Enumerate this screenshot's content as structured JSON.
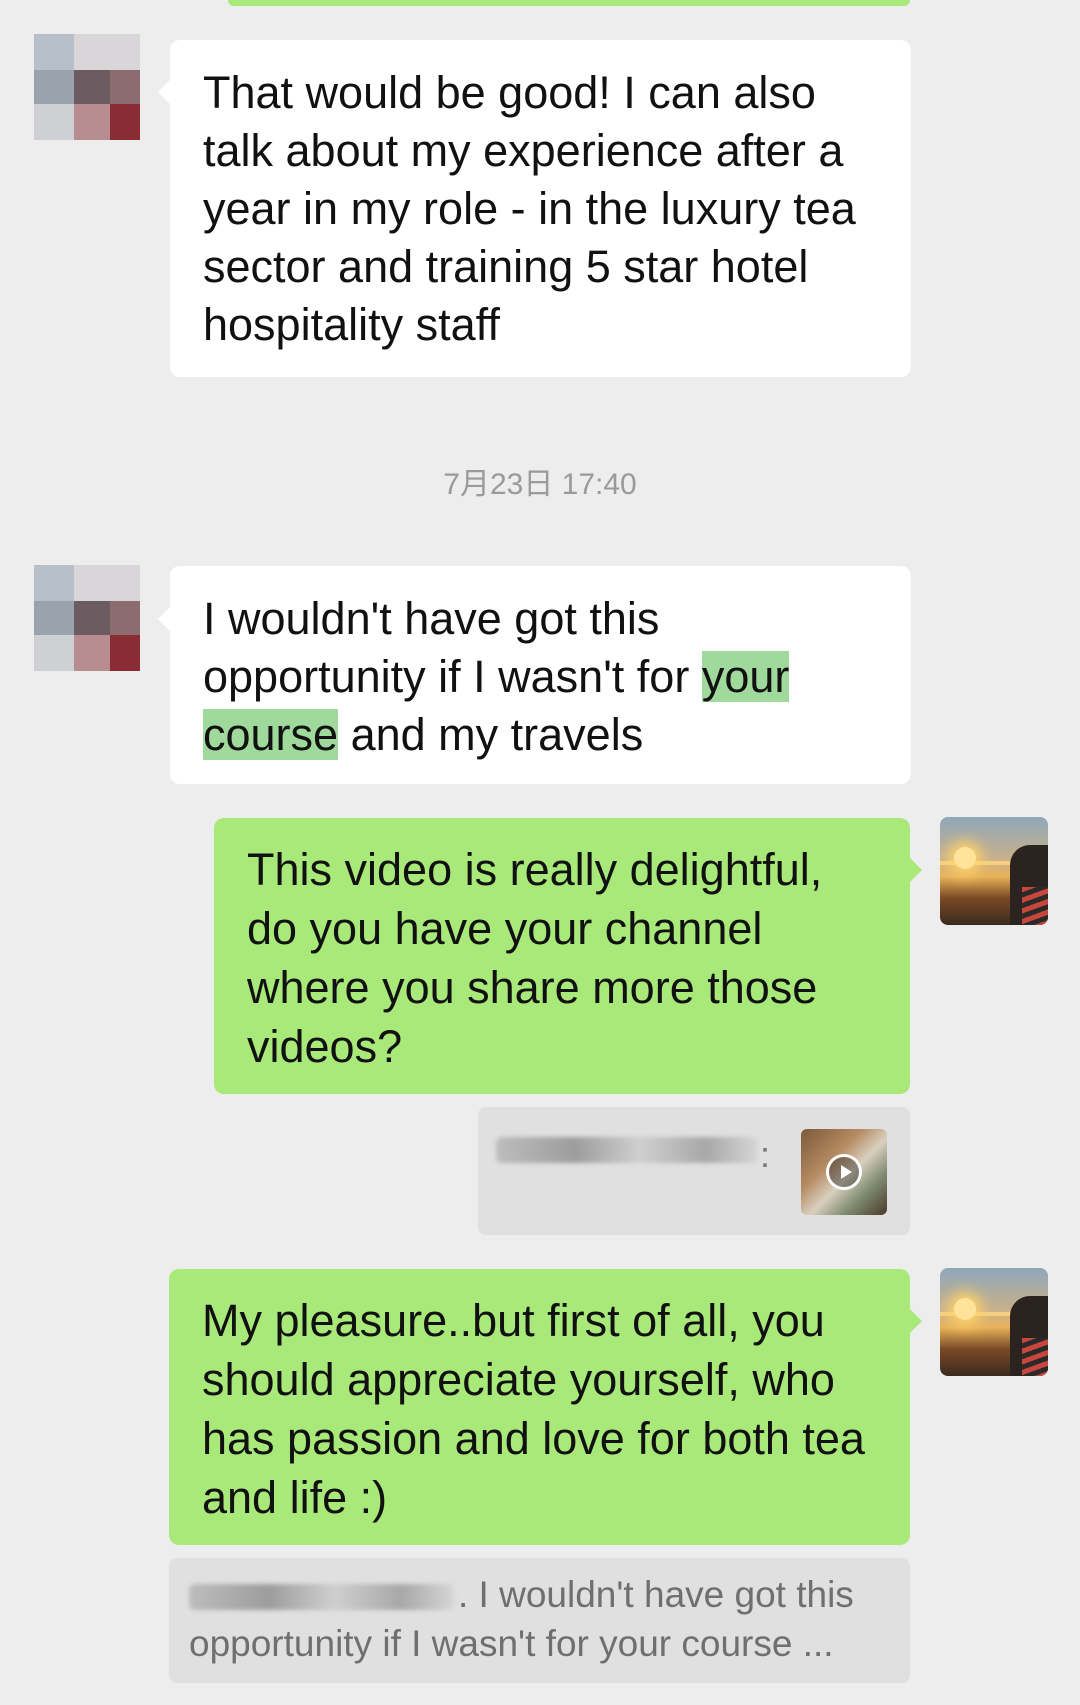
{
  "messages": [
    {
      "direction": "incoming",
      "text": "That would be good! I can also talk about my experience after a year in my role - in the luxury tea sector and training 5 star hotel hospitality staff"
    },
    {
      "direction": "incoming",
      "text_before": "I wouldn't have got this opportunity if I wasn't for ",
      "highlight": "your course",
      "text_after": " and my travels"
    },
    {
      "direction": "outgoing",
      "text": "This video is really delightful, do you have your channel where you share more those videos?"
    },
    {
      "direction": "outgoing",
      "text": "My pleasure..but first of all, you should appreciate yourself, who has passion and love for both tea and life :)"
    }
  ],
  "timestamp": "7月23日 17:40",
  "video_quote": {
    "name_suffix": ":",
    "thumbnail_icon": "play-icon"
  },
  "reply_quote": {
    "text": ". I wouldn't have got this opportunity if I wasn't for your course ..."
  },
  "colors": {
    "background": "#ededed",
    "incoming_bubble": "#ffffff",
    "outgoing_bubble": "#a9e97a",
    "highlight": "#9fd99c",
    "quote_bg": "#e0e0e0"
  }
}
